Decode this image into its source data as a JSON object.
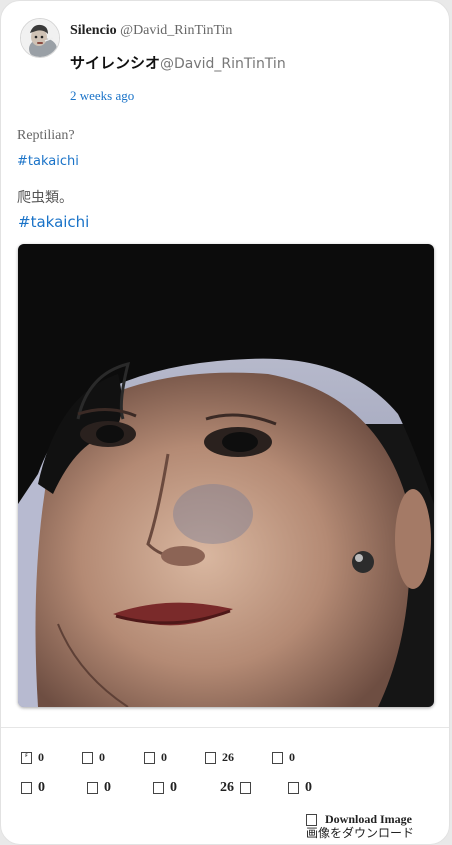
{
  "post": {
    "author_name": "Silencio",
    "author_handle": "@David_RinTinTin",
    "author_name_jp": "サイレンシオ",
    "author_handle_jp": "@David_RinTinTin",
    "timestamp": "2 weeks ago",
    "text_en": "Reptilian?",
    "hashtag_en": "#takaichi",
    "text_jp": "爬虫類。",
    "hashtag_jp": "#takaichi"
  },
  "stats_row1": [
    {
      "icon": "reply-icon",
      "value": "0"
    },
    {
      "icon": "retweet-icon",
      "value": "0"
    },
    {
      "icon": "quote-icon",
      "value": "0"
    },
    {
      "icon": "like-icon",
      "value": "26"
    },
    {
      "icon": "bookmark-icon",
      "value": "0"
    }
  ],
  "stats_row2": [
    {
      "icon": "reply-icon",
      "value": "0"
    },
    {
      "icon": "retweet-icon",
      "value": "0"
    },
    {
      "icon": "quote-icon",
      "value": "0"
    },
    {
      "icon": "like-icon",
      "value": "26"
    },
    {
      "icon": "bookmark-icon",
      "value": "0"
    }
  ],
  "download": {
    "label_en": "Download Image",
    "label_jp": "画像をダウンロード"
  },
  "colors": {
    "link": "#1a73c8",
    "card_bg": "#ffffff",
    "page_bg": "#e9e9e9"
  }
}
